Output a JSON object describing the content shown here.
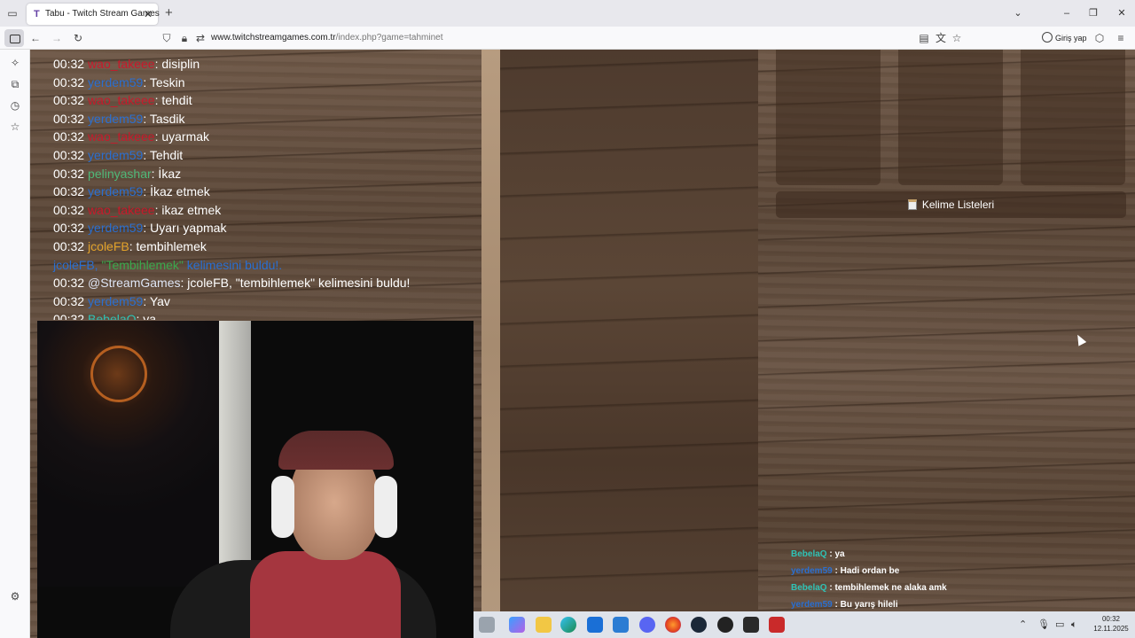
{
  "browser": {
    "tab_title": "Tabu - Twitch Stream Games",
    "tab_favicon": "T",
    "url_domain": "www.twitchstreamgames.com.tr",
    "url_path": "/index.php?game=tahminet",
    "login_label": "Giriş yap"
  },
  "chat": {
    "lines": [
      {
        "time": "00:32",
        "user": "wao_takeee",
        "text": ": disiplin"
      },
      {
        "time": "00:32",
        "user": "yerdem59",
        "text": ": Teskin"
      },
      {
        "time": "00:32",
        "user": "wao_takeee",
        "text": ": tehdit"
      },
      {
        "time": "00:32",
        "user": "yerdem59",
        "text": ": Tasdik"
      },
      {
        "time": "00:32",
        "user": "wao_takeee",
        "text": ": uyarmak"
      },
      {
        "time": "00:32",
        "user": "yerdem59",
        "text": ": Tehdit"
      },
      {
        "time": "00:32",
        "user": "pelinyashar",
        "text": ": İkaz"
      },
      {
        "time": "00:32",
        "user": "yerdem59",
        "text": ": İkaz etmek"
      },
      {
        "time": "00:32",
        "user": "wao_takeee",
        "text": ": ikaz etmek"
      },
      {
        "time": "00:32",
        "user": "yerdem59",
        "text": ": Uyarı yapmak"
      },
      {
        "time": "00:32",
        "user": "jcoleFB",
        "text": ": tembihlemek"
      }
    ],
    "notice": {
      "user": "jcoleFB,",
      "quote": "\"Tembihlemek\"",
      "rest": "kelimesini buldu!."
    },
    "bot_line": {
      "time": "00:32",
      "user": "@StreamGames",
      "text": ": jcoleFB, \"tembihlemek\" kelimesini buldu!"
    },
    "last_line": {
      "time": "00:32",
      "user": "yerdem59",
      "text": ": Yav"
    },
    "partial_line": {
      "time": "00:32",
      "user": "BebelaQ",
      "text": ": ya"
    }
  },
  "word_lists_label": "Kelime Listeleri",
  "overlay_chat": [
    {
      "user": "BebelaQ",
      "text": ": ya"
    },
    {
      "user": "yerdem59",
      "text": ": Hadi ordan be"
    },
    {
      "user": "BebelaQ",
      "text": ": tembihlemek ne alaka amk"
    },
    {
      "user": "yerdem59",
      "text": ": Bu yarış hileli"
    }
  ],
  "clock": {
    "time": "00:32",
    "date": "12.11.2025"
  },
  "colors": {
    "user_red": "#c8192b",
    "user_blue": "#2a6fd1",
    "user_green": "#4fb878",
    "user_orange": "#e1a12a",
    "user_cyan": "#2fc2b5"
  }
}
